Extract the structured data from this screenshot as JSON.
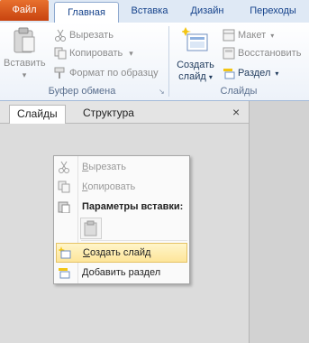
{
  "tabs": {
    "file": "Файл",
    "home": "Главная",
    "insert": "Вставка",
    "design": "Дизайн",
    "transitions": "Переходы"
  },
  "clipboard_group": {
    "paste": "Вставить",
    "cut": "Вырезать",
    "copy": "Копировать",
    "copy_dropdown": "▾",
    "format_painter": "Формат по образцу",
    "title": "Буфер обмена"
  },
  "slides_group": {
    "new_slide_line1": "Создать",
    "new_slide_line2": "слайд",
    "layout": "Макет",
    "reset": "Восстановить",
    "section": "Раздел",
    "title": "Слайды"
  },
  "pane": {
    "tab_slides": "Слайды",
    "tab_outline": "Структура",
    "close": "×"
  },
  "context_menu": {
    "cut": {
      "first": "В",
      "rest": "ырезать"
    },
    "copy": {
      "first": "К",
      "rest": "опировать"
    },
    "paste_options": "Параметры вставки:",
    "new_slide": {
      "first": "С",
      "rest": "оздать слайд"
    },
    "add_section": {
      "first": "Д",
      "rest": "обавить раздел"
    }
  },
  "colors": {
    "file_tab": "#d9561c",
    "ribbon_text": "#1e395b",
    "highlight": "#fde59a"
  }
}
